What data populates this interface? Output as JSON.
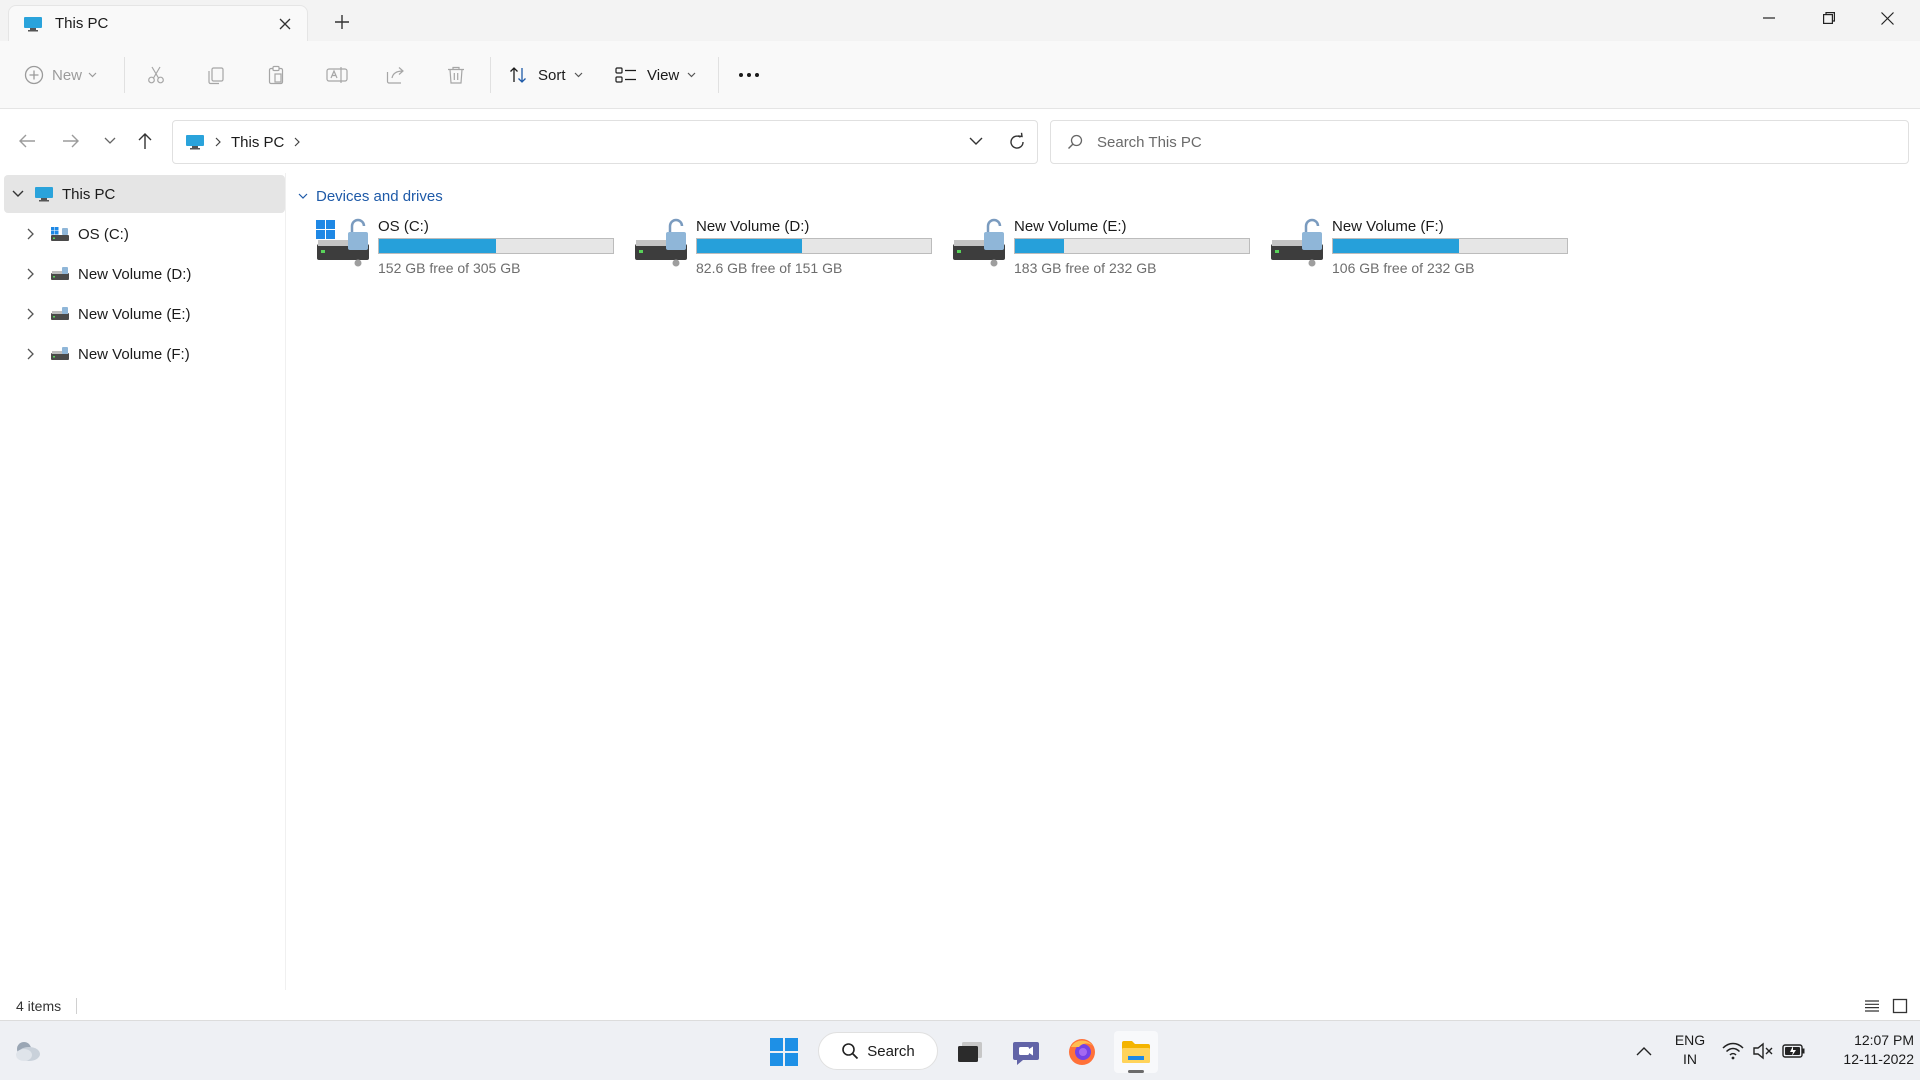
{
  "window": {
    "tab_title": "This PC",
    "tab_close_icon": "close-icon",
    "new_tab_icon": "plus-icon",
    "controls": [
      "minimize-icon",
      "restore-icon",
      "close-icon"
    ]
  },
  "toolbar": {
    "new_label": "New",
    "sort_label": "Sort",
    "view_label": "View",
    "icons": [
      "cut-icon",
      "copy-icon",
      "paste-icon",
      "rename-icon",
      "share-icon",
      "delete-icon",
      "more-icon"
    ]
  },
  "address": {
    "crumb": "This PC"
  },
  "search": {
    "placeholder": "Search This PC"
  },
  "nav": {
    "items": [
      {
        "label": "This PC"
      },
      {
        "label": "OS (C:)"
      },
      {
        "label": "New Volume (D:)"
      },
      {
        "label": "New Volume (E:)"
      },
      {
        "label": "New Volume (F:)"
      }
    ]
  },
  "content": {
    "group_title": "Devices and drives",
    "drives": [
      {
        "name": "OS (C:)",
        "free": "152 GB free of 305 GB",
        "used_fraction": 0.5
      },
      {
        "name": "New Volume (D:)",
        "free": "82.6 GB free of 151 GB",
        "used_fraction": 0.45
      },
      {
        "name": "New Volume (E:)",
        "free": "183 GB free of 232 GB",
        "used_fraction": 0.21
      },
      {
        "name": "New Volume (F:)",
        "free": "106 GB free of 232 GB",
        "used_fraction": 0.54
      }
    ]
  },
  "status": {
    "count": "4 items"
  },
  "taskbar": {
    "search_label": "Search",
    "lang_line1": "ENG",
    "lang_line2": "IN",
    "time": "12:07 PM",
    "date": "12-11-2022"
  },
  "colors": {
    "accent": "#26a0da",
    "link": "#1e5aa8"
  }
}
